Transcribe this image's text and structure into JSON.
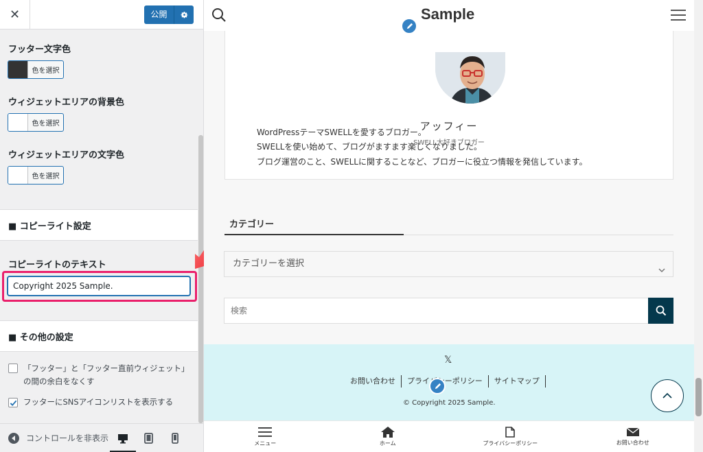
{
  "panel": {
    "close_label": "✕",
    "publish_label": "公開",
    "footer_text_color_label": "フッター文字色",
    "widget_bg_label": "ウィジェットエリアの背景色",
    "widget_text_label": "ウィジェットエリアの文字色",
    "select_color": "色を選択",
    "copyright_section": "■ コピーライト設定",
    "copyright_text_label": "コピーライトのテキスト",
    "copyright_value": "Copyright 2025 Sample.",
    "other_section": "■ その他の設定",
    "check1_line1": "「フッター」と「フッター直前ウィジェット」",
    "check1_line2": "の間の余白をなくす",
    "check1_checked": false,
    "check2": "フッターにSNSアイコンリストを表示する",
    "check2_checked": true,
    "collapse_label": "コントロールを非表示",
    "swatch_colors": [
      "#333333",
      "#ffffff",
      "#ffffff"
    ],
    "accent": "#2271b1",
    "highlight": "#ea1f6b"
  },
  "preview": {
    "site_title": "Sample",
    "author_name": "アッフィー",
    "author_role": "SWELL大好きブロガー",
    "bio": [
      "WordPressテーマSWELLを愛するブロガー。",
      "SWELLを使い始めて、ブログがますます楽しくなりました。",
      "ブログ運営のこと、SWELLに関することなど、ブロガーに役立つ情報を発信しています。"
    ],
    "category_heading": "カテゴリー",
    "category_select": "カテゴリーを選択",
    "search_placeholder": "検索",
    "x_icon": "𝕏",
    "footer_links": [
      "お問い合わせ",
      "プライバシーポリシー",
      "サイトマップ"
    ],
    "copyright": "© Copyright 2025 Sample.",
    "fix_menu": [
      "メニュー",
      "ホーム",
      "プライバシーポリシー",
      "お問い合わせ"
    ],
    "footer_bg": "#d7f4f7",
    "main_color": "#04384c"
  }
}
